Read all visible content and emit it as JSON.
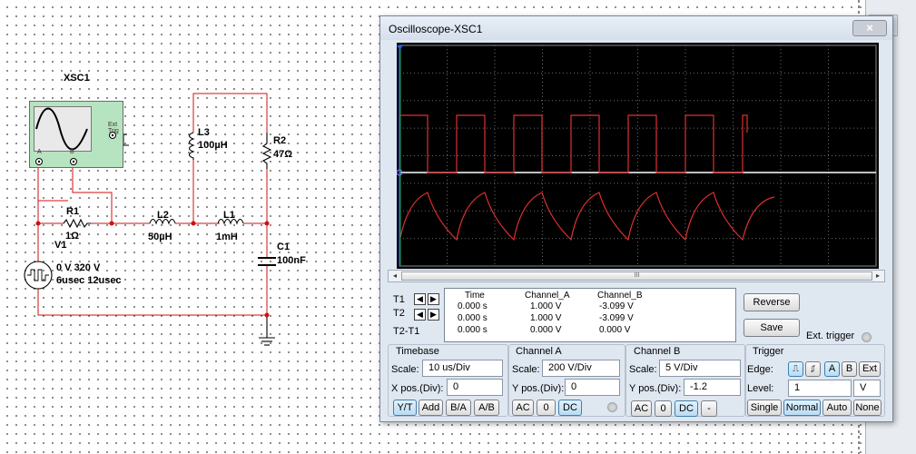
{
  "schematic": {
    "xsc1_label": "XSC1",
    "ext_trig_label": "Ext Trig",
    "port_a": "A",
    "port_b": "B",
    "r1": {
      "name": "R1",
      "value": "1Ω"
    },
    "v1": {
      "name": "V1",
      "line1": "0 V 320 V",
      "line2": "6usec 12usec"
    },
    "l2": {
      "name": "L2",
      "value": "50µH"
    },
    "l1": {
      "name": "L1",
      "value": "1mH"
    },
    "l3": {
      "name": "L3",
      "value": "100µH"
    },
    "r2": {
      "name": "R2",
      "value": "47Ω"
    },
    "c1": {
      "name": "C1",
      "value": "100nF"
    },
    "wire_color": "#d01010"
  },
  "scope_window": {
    "title": "Oscilloscope-XSC1",
    "close_icon": "×",
    "scroll_grip": "III",
    "scroll_left": "◂",
    "scroll_right": "▸",
    "trace_a_color": "#e03030",
    "trace_b_color": "#ffffff",
    "cursor_color": "#2060ff",
    "screen_grid": {
      "cols": 10,
      "rows": 8
    },
    "cursors": {
      "t1": "T1",
      "t2": "T2",
      "diff": "T2-T1"
    },
    "readout": {
      "headers": [
        "Time",
        "Channel_A",
        "Channel_B"
      ],
      "rows": [
        [
          "0.000 s",
          "1.000 V",
          "-3.099 V"
        ],
        [
          "0.000 s",
          "1.000 V",
          "-3.099 V"
        ],
        [
          "0.000 s",
          "0.000 V",
          "0.000 V"
        ]
      ]
    },
    "reverse_label": "Reverse",
    "save_label": "Save",
    "ext_trigger_label": "Ext. trigger",
    "timebase": {
      "title": "Timebase",
      "scale_label": "Scale:",
      "scale_value": "10 us/Div",
      "xpos_label": "X pos.(Div):",
      "xpos_value": "0",
      "buttons": [
        "Y/T",
        "Add",
        "B/A",
        "A/B"
      ]
    },
    "channel_a": {
      "title": "Channel A",
      "scale_label": "Scale:",
      "scale_value": "200  V/Div",
      "ypos_label": "Y pos.(Div):",
      "ypos_value": "0",
      "buttons": [
        "AC",
        "0",
        "DC"
      ]
    },
    "channel_b": {
      "title": "Channel B",
      "scale_label": "Scale:",
      "scale_value": "5  V/Div",
      "ypos_label": "Y pos.(Div):",
      "ypos_value": "-1.2",
      "buttons": [
        "AC",
        "0",
        "DC",
        "-"
      ]
    },
    "trigger": {
      "title": "Trigger",
      "edge_label": "Edge:",
      "edge_buttons": [
        "⎍",
        "⎎",
        "A",
        "B",
        "Ext"
      ],
      "level_label": "Level:",
      "level_value": "1",
      "level_unit": "V",
      "mode_buttons": [
        "Single",
        "Normal",
        "Auto",
        "None"
      ]
    }
  }
}
